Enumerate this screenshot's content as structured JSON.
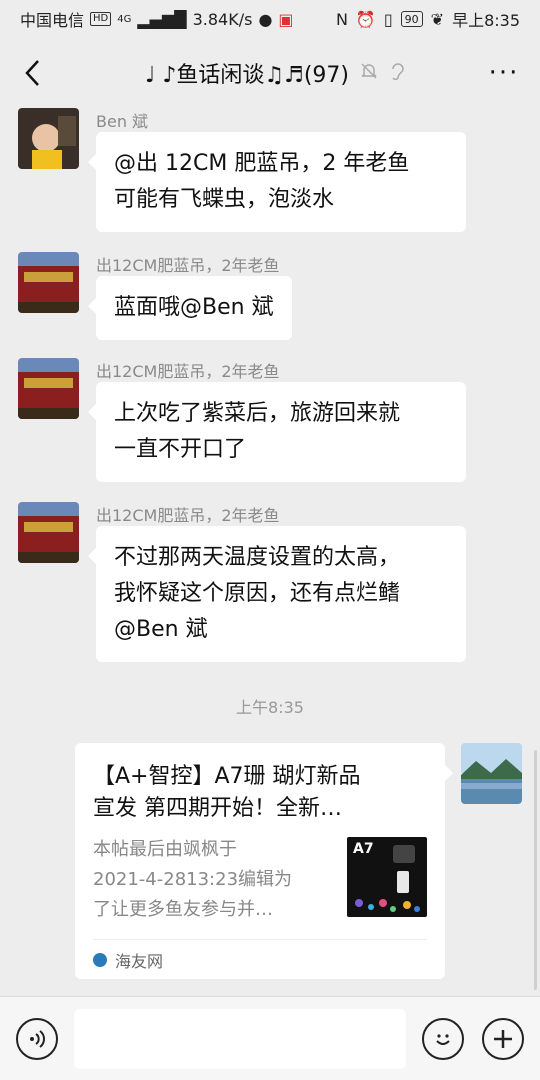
{
  "status": {
    "carrier": "中国电信",
    "hd_badge": "HD",
    "network": "4G",
    "speed": "3.84K/s",
    "battery": "90",
    "time": "早上8:35"
  },
  "header": {
    "title": "♩ ♪鱼话闲谈♫♬(97)",
    "more": "···"
  },
  "messages": [
    {
      "sender": "Ben 斌",
      "text_lines": [
        "@出 12CM 肥蓝吊，2 年老鱼",
        "可能有飞蝶虫，泡淡水"
      ]
    },
    {
      "sender": "出12CM肥蓝吊，2年老鱼",
      "text_lines": [
        "蓝面哦@Ben 斌"
      ]
    },
    {
      "sender": "出12CM肥蓝吊，2年老鱼",
      "text_lines": [
        "上次吃了紫菜后，旅游回来就",
        "一直不开口了"
      ]
    },
    {
      "sender": "出12CM肥蓝吊，2年老鱼",
      "text_lines": [
        "不过那两天温度设置的太高，",
        "我怀疑这个原因，还有点烂鳍",
        "@Ben 斌"
      ]
    }
  ],
  "timestamp": "上午8:35",
  "card": {
    "title_lines": [
      "【A+智控】A7珊 瑚灯新品",
      "宣发  第四期开始！全新…"
    ],
    "desc_lines": [
      "本帖最后由飒枫于",
      "2021-4-2813:23编辑为",
      "了让更多鱼友参与并…"
    ],
    "thumb_text": "A7",
    "source": "海友网"
  },
  "colors": {
    "background": "#ededed",
    "bubble": "#ffffff"
  }
}
